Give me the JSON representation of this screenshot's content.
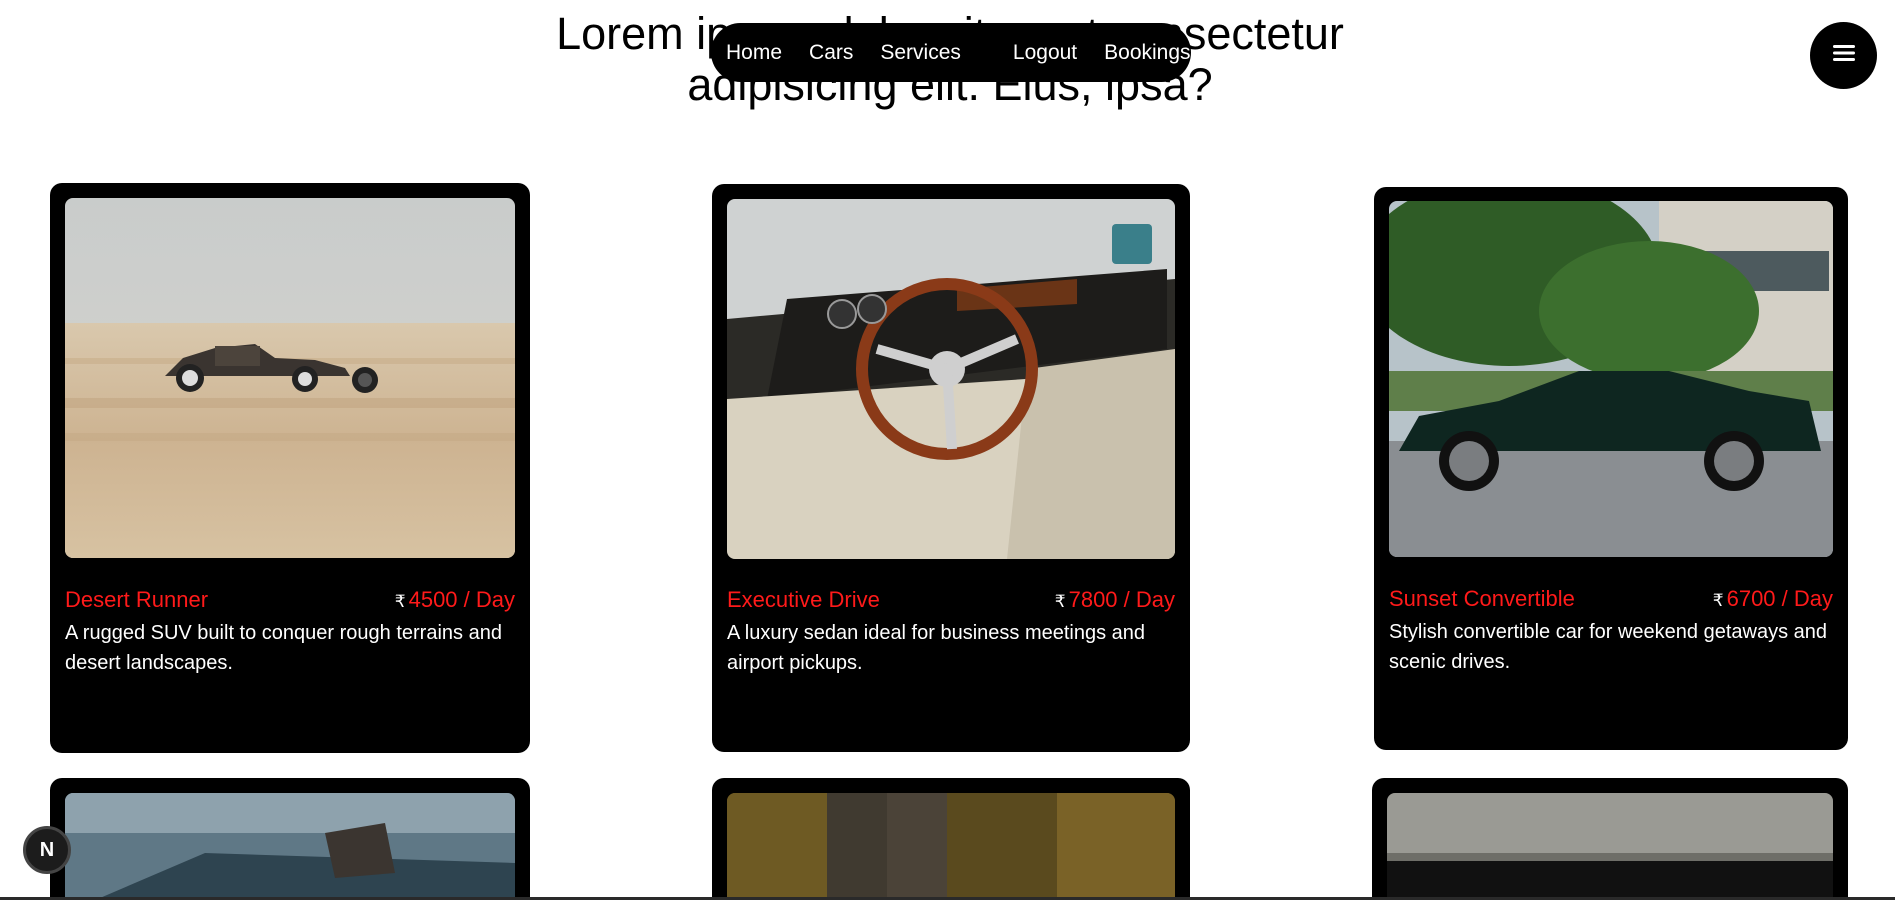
{
  "hero": {
    "heading": "Lorem ipsum dolor sit amet consectetur adipisicing elit. Eius, ipsa?"
  },
  "nav": {
    "links": [
      "Home",
      "Cars",
      "Services",
      "Logout",
      "Bookings"
    ]
  },
  "menu_icon": "hamburger-icon",
  "currency_symbol": "₹",
  "cards": [
    {
      "title": "Desert Runner",
      "price": "4500 / Day",
      "description": "A rugged SUV built to conquer rough terrains and desert landscapes."
    },
    {
      "title": "Executive Drive",
      "price": "7800 / Day",
      "description": "A luxury sedan ideal for business meetings and airport pickups."
    },
    {
      "title": "Sunset Convertible",
      "price": "6700 / Day",
      "description": "Stylish convertible car for weekend getaways and scenic drives."
    }
  ],
  "badge": {
    "label": "N"
  },
  "colors": {
    "accent": "#ff1a1a",
    "card_bg": "#000000"
  }
}
